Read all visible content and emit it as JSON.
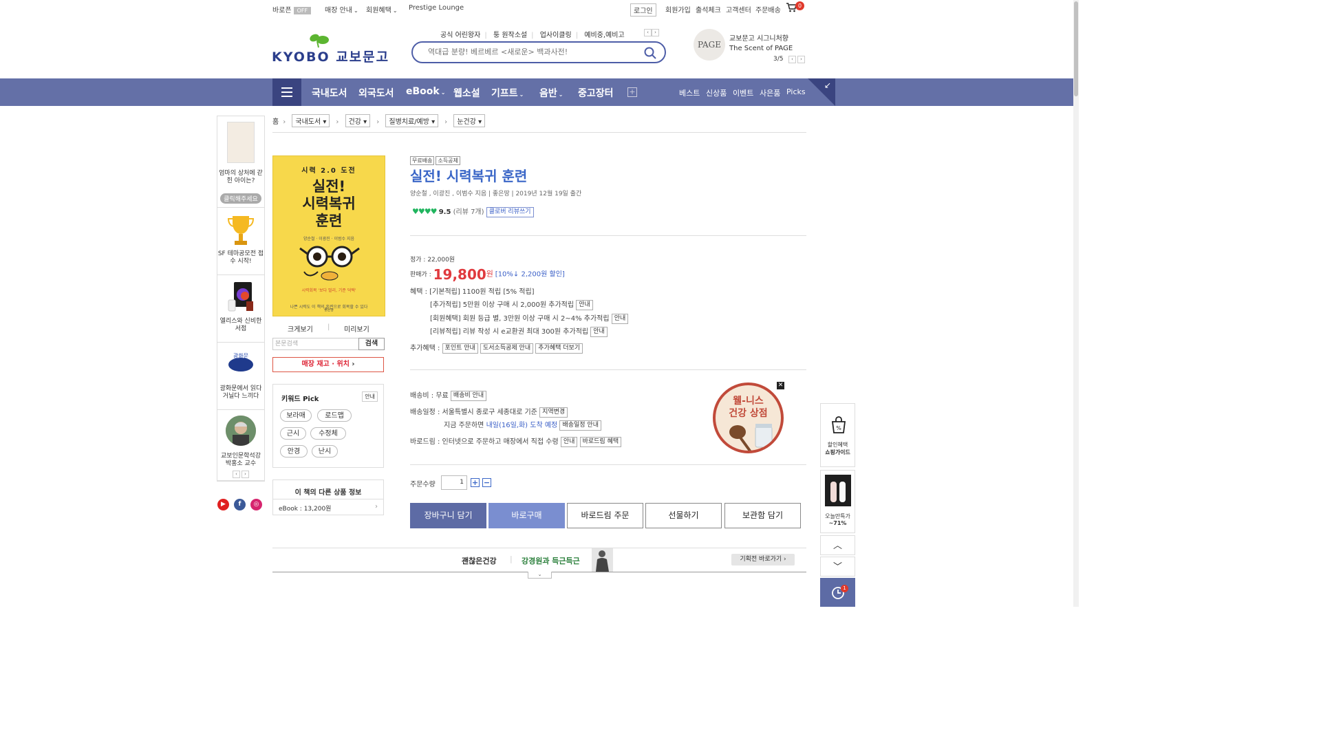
{
  "util_bar": {
    "left": [
      {
        "label": "바로픈",
        "badge": "OFF"
      },
      {
        "label": "매장 안내",
        "dropdown": true
      },
      {
        "label": "회원혜택",
        "dropdown": true
      },
      {
        "label": "Prestige Lounge"
      }
    ],
    "right": [
      "로그인",
      "회원가입",
      "출석체크",
      "고객센터",
      "주문배송"
    ],
    "cart_count": "0"
  },
  "header": {
    "logo_text": "KYOBO 교보문고",
    "quick_links": [
      "공식 어린왕자",
      "퉁 원작소설",
      "업사이클링",
      "예비중,예비고"
    ],
    "search_placeholder": "역대급 분량! 베르베르 <새로운> 백과사전!",
    "banner_title_1": "교보문고 시그니처향",
    "banner_title_2": "The Scent of PAGE",
    "banner_badge": "PAGE",
    "banner_counter": "3/5"
  },
  "nav": {
    "categories": [
      "국내도서",
      "외국도서",
      "eBook",
      "웹소설",
      "기프트",
      "음반",
      "중고장터"
    ],
    "dropdown_flags": [
      false,
      false,
      true,
      false,
      true,
      true,
      false
    ],
    "right_links": [
      "베스트",
      "신상품",
      "이벤트",
      "사은품",
      "Picks"
    ],
    "corner_icon": "↙"
  },
  "left_sidebar": {
    "items": [
      {
        "caption": "엄마의 상처에 갇힌 아이는?",
        "pill": "클릭해주세요"
      },
      {
        "caption": "SF 테마공모전 접수 시작!"
      },
      {
        "caption": "엘리스와 신비한 서점"
      },
      {
        "caption": "광화문에서 읽다 거닐다 느끼다"
      },
      {
        "caption": "교보인문학석강 박홍소 교수"
      }
    ],
    "pager_prev": "‹",
    "pager_next": "›",
    "social": [
      "youtube",
      "facebook",
      "instagram"
    ]
  },
  "breadcrumb": {
    "home": "홈",
    "levels": [
      "국내도서",
      "건강",
      "질병치료/예방",
      "눈건강"
    ]
  },
  "cover": {
    "series": "시력 2.0 도전",
    "title_lines": [
      "실전!",
      "시력복귀",
      "훈련"
    ],
    "authors": "양순철 · 이광진 · 이범수 지음",
    "catch": "시력회복 '보다 멀리, 기준 덕택'",
    "desc": "나쁜 시력도 이 책의 훈련으로 회복할 수 있다",
    "publisher": "좋은땅"
  },
  "cover_links": {
    "zoom": "크게보기",
    "preview": "미리보기"
  },
  "body_search": {
    "placeholder": "본문검색",
    "button": "검색"
  },
  "stock_button": "매장 재고 · 위치",
  "keyword_pick": {
    "title": "키워드 Pick",
    "info": "안내",
    "tags": [
      "보라매",
      "로드맵",
      "근시",
      "수정체",
      "안경",
      "난시"
    ]
  },
  "other_products": {
    "title": "이 책의 다른 상품 정보",
    "item": "eBook : 13,200원",
    "arrow": "›"
  },
  "product": {
    "tags": [
      "무료배송",
      "소득공제"
    ],
    "title": "실전! 시력복귀 훈련",
    "meta": "양순철 , 이광진 , 이범수 지음 | 좋은땅 | 2019년 12월 19일 출간",
    "rating": "9.5",
    "rating_count": "(리뷰 7개)",
    "review_button": "클로버 리뷰쓰기",
    "list_price": "정가 : 22,000원",
    "sale_label": "판매가 :",
    "sale_price": "19,800",
    "sale_unit": "원",
    "discount": "[10%↓ 2,200원 할인]",
    "benefit_label": "혜택 :",
    "benefit_main": "[기본적립] 1100원 적립 [5% 적립]",
    "benefits": [
      {
        "text": "[추가적립] 5만원 이상 구매 시 2,000원 추가적립",
        "btn": "안내"
      },
      {
        "text": "[회원혜택] 회원 등급 별, 3만원 이상 구매 시 2~4% 추가적립",
        "btn": "안내"
      },
      {
        "text": "[리뷰적립] 리뷰 작성 시 e교환권 최대 300원 추가적립",
        "btn": "안내"
      }
    ],
    "extra_label": "추가혜택 :",
    "extra_buttons": [
      "포인트 안내",
      "도서소득공제 안내",
      "추가혜택 더보기"
    ],
    "shipping_fee_label": "배송비 : 무료",
    "shipping_fee_btn": "배송비 안내",
    "shipping_schedule_label": "배송일정 : 서울특별시 종로구 세종대로 기준",
    "shipping_region_btn": "지역변경",
    "shipping_eta_prefix": "지금 주문하면",
    "shipping_eta": "내일(16일,화) 도착 예정",
    "shipping_eta_btn": "배송일정 안내",
    "barodrim_label": "바로드림 : 인터넷으로 주문하고 매장에서 직접 수령",
    "barodrim_btns": [
      "안내",
      "바로드림 혜택"
    ],
    "qty_label": "주문수량",
    "qty_value": "1",
    "qty_plus": "+",
    "qty_minus": "−",
    "actions": [
      "장바구니 담기",
      "바로구매",
      "바로드림 주문",
      "선물하기",
      "보관함 담기"
    ]
  },
  "promo": {
    "line1": "웰-니스",
    "line2": "건강 상점",
    "close": "✕"
  },
  "bottom_banner": {
    "left": "괜찮은건강",
    "mid": "강경원과 득근득근",
    "button": "기획전 바로가기 ›",
    "tab": "⌄"
  },
  "right_sidebar": {
    "guide_1": "할인혜택",
    "guide_2": "쇼핑가이드",
    "deal_1": "오늘만특가",
    "deal_2": "~71%",
    "up": "︿",
    "down": "﹀",
    "recent_count": "1"
  }
}
